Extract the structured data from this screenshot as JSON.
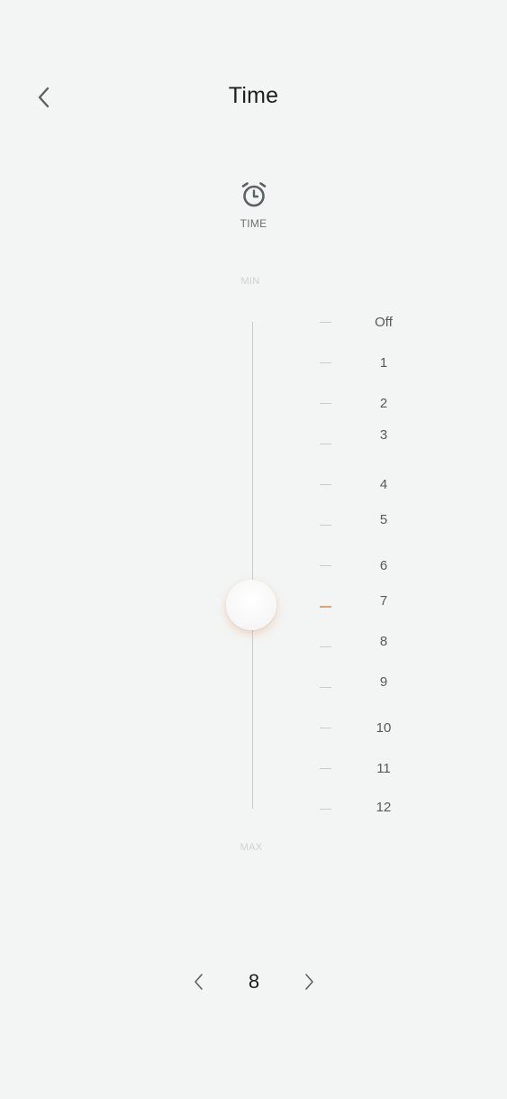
{
  "header": {
    "title": "Time",
    "back_icon": "chevron-left-icon"
  },
  "mode": {
    "icon": "alarm-clock-icon",
    "label": "TIME"
  },
  "slider": {
    "min_label": "MIN",
    "max_label": "MAX",
    "selected_index": 7,
    "accent_color": "#e0a070",
    "scale": [
      {
        "label": "Off"
      },
      {
        "label": "1"
      },
      {
        "label": "2"
      },
      {
        "label": "3"
      },
      {
        "label": "4"
      },
      {
        "label": "5"
      },
      {
        "label": "6"
      },
      {
        "label": "7"
      },
      {
        "label": "8"
      },
      {
        "label": "9"
      },
      {
        "label": "10"
      },
      {
        "label": "11"
      },
      {
        "label": "12"
      }
    ]
  },
  "stepper": {
    "value": "8",
    "prev_icon": "chevron-left-icon",
    "next_icon": "chevron-right-icon"
  }
}
